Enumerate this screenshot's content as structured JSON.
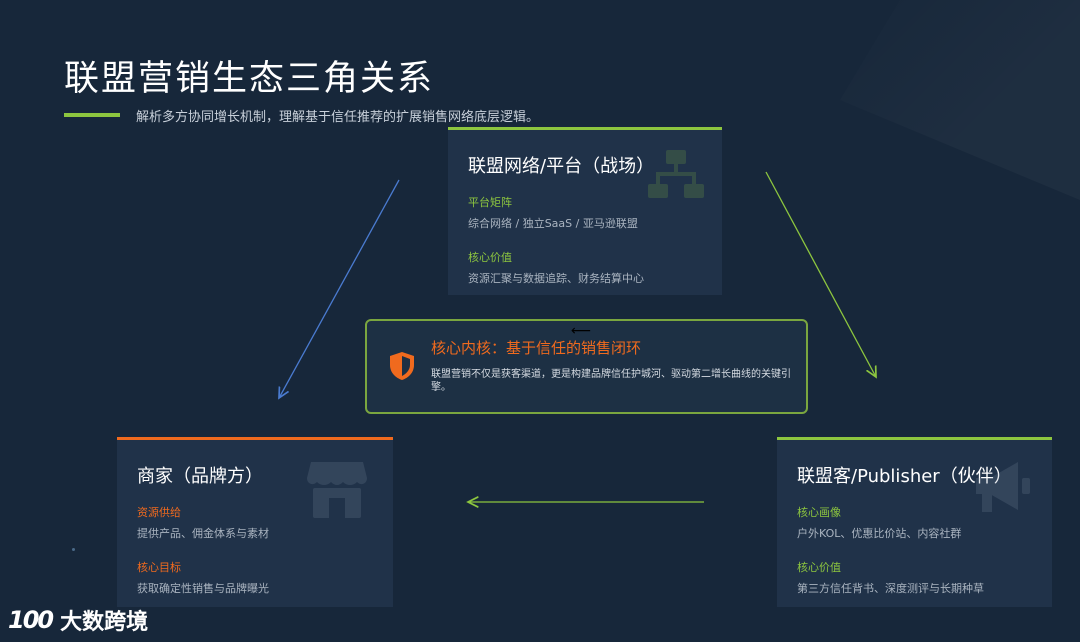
{
  "header": {
    "title": "联盟营销生态三角关系",
    "subtitle": "解析多方协同增长机制，理解基于信任推荐的扩展销售网络底层逻辑。"
  },
  "nodes": {
    "platform": {
      "title": "联盟网络/平台（战场）",
      "sec1_label": "平台矩阵",
      "sec1_text": "综合网络 / 独立SaaS / 亚马逊联盟",
      "sec2_label": "核心价值",
      "sec2_text": "资源汇聚与数据追踪、财务结算中心",
      "icon": "network-icon"
    },
    "merchant": {
      "title": "商家（品牌方）",
      "sec1_label": "资源供给",
      "sec1_text": "提供产品、佣金体系与素材",
      "sec2_label": "核心目标",
      "sec2_text": "获取确定性销售与品牌曝光",
      "icon": "store-icon"
    },
    "publisher": {
      "title": "联盟客/Publisher（伙伴）",
      "sec1_label": "核心画像",
      "sec1_text": "户外KOL、优惠比价站、内容社群",
      "sec2_label": "核心价值",
      "sec2_text": "第三方信任背书、深度测评与长期种草",
      "icon": "megaphone-icon"
    }
  },
  "core": {
    "title": "核心内核：基于信任的销售闭环",
    "text": "联盟营销不仅是获客渠道，更是构建品牌信任护城河、驱动第二增长曲线的关键引擎。",
    "icon": "shield-icon",
    "small_arrow": "⟵"
  },
  "logo": {
    "mark": "100",
    "text": "大数跨境"
  },
  "colors": {
    "background": "#17273a",
    "card": "#203249",
    "green": "#8dc63f",
    "orange": "#f06a1e",
    "blue_arrow": "#4a7bd0"
  }
}
